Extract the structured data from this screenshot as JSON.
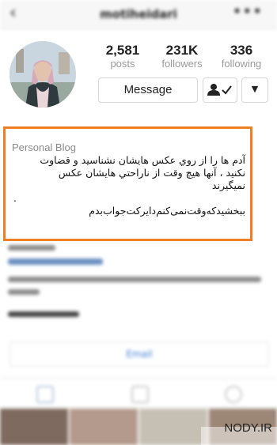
{
  "nav": {
    "username": "motiheidari"
  },
  "profile": {
    "stats": [
      {
        "value": "2,581",
        "label": "posts"
      },
      {
        "value": "231K",
        "label": "followers"
      },
      {
        "value": "336",
        "label": "following"
      }
    ],
    "message_label": "Message"
  },
  "bio": {
    "category": "Personal Blog",
    "line1": "آدم ها را از روي عكس هايشان نشناسيد و قضاوت",
    "line2": "نكنيد ، آنها هيچ وقت از ناراحتي هايشان عكس",
    "line3": "نميگيرند",
    "line4": ".",
    "line5": "ببخشیدکه‌وقت‌نمی‌کنم‌دایرکت‌جواب‌بدم"
  },
  "email_label": "Email",
  "watermark": "NODY.IR"
}
